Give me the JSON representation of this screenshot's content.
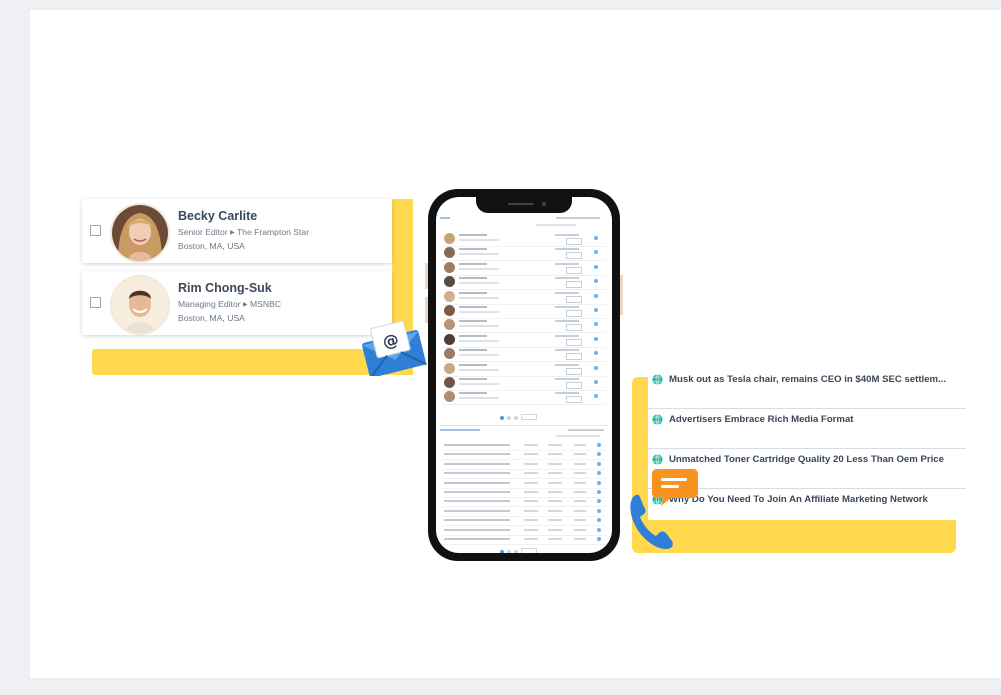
{
  "contacts": [
    {
      "name": "Becky Carlite",
      "role": "Senior Editor",
      "outlet": "The Frampton Star",
      "location": "Boston, MA, USA"
    },
    {
      "name": "Rim Chong-Suk",
      "role": "Managing Editor",
      "outlet": "MSNBC",
      "location": "Boston, MA, USA"
    }
  ],
  "email_badge": {
    "symbol": "@"
  },
  "news": [
    {
      "headline": "Musk out as Tesla chair, remains CEO in $40M SEC settlem..."
    },
    {
      "headline": "Advertisers Embrace Rich Media Format"
    },
    {
      "headline": "Unmatched Toner Cartridge Quality 20 Less Than Oem Price"
    },
    {
      "headline": "Why Do You Need To Join An Affiliate Marketing Network"
    }
  ],
  "colors": {
    "accent_yellow": "#ffd84d",
    "accent_blue": "#2f7fd6",
    "chat_orange": "#f7931e",
    "globe_teal": "#2bb3a3"
  }
}
